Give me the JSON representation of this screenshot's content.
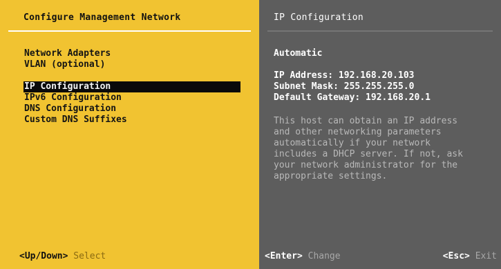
{
  "left_pane": {
    "title": "Configure Management Network",
    "menu": [
      "Network Adapters",
      "VLAN (optional)",
      "IP Configuration",
      "IPv6 Configuration",
      "DNS Configuration",
      "Custom DNS Suffixes"
    ],
    "selected_item": "IP Configuration",
    "footer": {
      "key": "<Up/Down>",
      "action": "Select"
    }
  },
  "right_pane": {
    "title": "IP Configuration",
    "mode": "Automatic",
    "ip_address": "IP Address: 192.168.20.103",
    "subnet_mask": "Subnet Mask: 255.255.255.0",
    "default_gateway": "Default Gateway: 192.168.20.1",
    "description": "This host can obtain an IP address\nand other networking parameters\nautomatically if your network\nincludes a DHCP server. If not, ask\nyour network administrator for the\nappropriate settings.",
    "footer_enter": {
      "key": "<Enter>",
      "action": "Change"
    },
    "footer_esc": {
      "key": "<Esc>",
      "action": "Exit"
    }
  },
  "colors": {
    "left_background": "#f1c331",
    "right_background": "#5d5d5d",
    "selection_background": "#0a0a0a"
  }
}
